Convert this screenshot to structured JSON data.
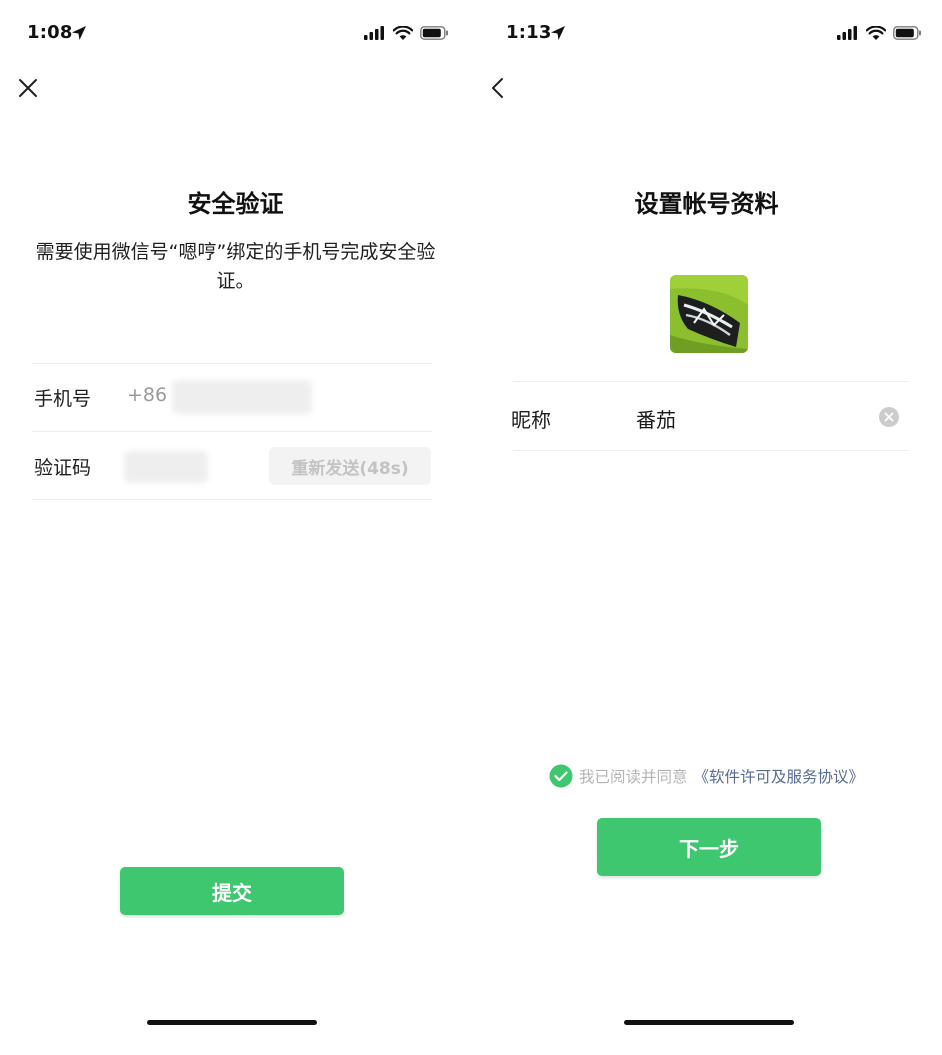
{
  "left_screen": {
    "status_time": "1:08",
    "title": "安全验证",
    "description": "需要使用微信号“嗯哼”绑定的手机号完成安全验证。",
    "phone_label": "手机号",
    "phone_prefix": "+86",
    "code_label": "验证码",
    "resend_label": "重新发送(48s)",
    "submit_label": "提交",
    "nav_icon": "close-icon"
  },
  "right_screen": {
    "status_time": "1:13",
    "title": "设置帐号资料",
    "nickname_label": "昵称",
    "nickname_value": "番茄",
    "agree_text": "我已阅读并同意",
    "agree_link": "《软件许可及服务协议》",
    "next_label": "下一步",
    "nav_icon": "back-chevron-icon"
  },
  "colors": {
    "accent_green": "#3fc770",
    "link_blue": "#576b95",
    "disabled_text": "#c3c3c3"
  }
}
